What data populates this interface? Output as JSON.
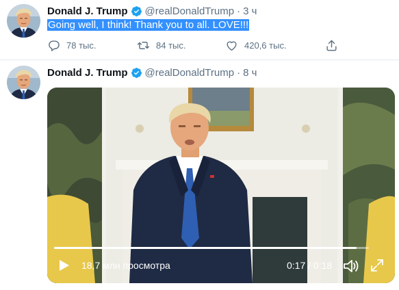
{
  "tweets": [
    {
      "author": "Donald J. Trump",
      "handle": "@realDonaldTrump",
      "separator": "·",
      "time": "3 ч",
      "text": "Going well, I think! Thank you to all. LOVE!!!",
      "actions": {
        "reply": {
          "icon": "reply-icon",
          "count": "78 тыс."
        },
        "retweet": {
          "icon": "retweet-icon",
          "count": "84 тыс."
        },
        "like": {
          "icon": "heart-icon",
          "count": "420,6 тыс."
        },
        "share": {
          "icon": "share-icon"
        }
      }
    },
    {
      "author": "Donald J. Trump",
      "handle": "@realDonaldTrump",
      "separator": "·",
      "time": "8 ч",
      "video": {
        "views": "18,7 млн просмотра",
        "time": "0:17 / 0:18",
        "progress": 0.96,
        "icons": {
          "play": "play-icon",
          "volume": "volume-icon",
          "fullscreen": "fullscreen-icon"
        }
      }
    }
  ],
  "colors": {
    "verified": "#1da1f2",
    "selection": "#3390ff",
    "muted_text": "#5b7083",
    "divider": "#e6ecf0"
  }
}
